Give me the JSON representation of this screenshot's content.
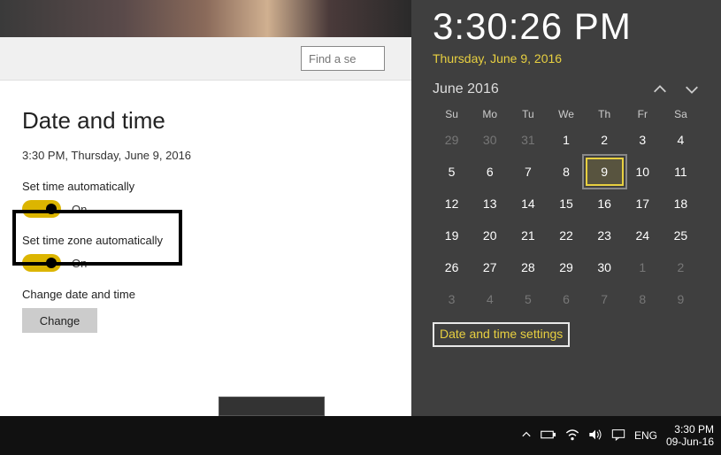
{
  "search": {
    "placeholder": "Find a se"
  },
  "settings": {
    "title": "Date and time",
    "current": "3:30 PM, Thursday, June 9, 2016",
    "set_time_auto": {
      "label": "Set time automatically",
      "state": "On"
    },
    "set_tz_auto": {
      "label": "Set time zone automatically",
      "state": "On"
    },
    "change_section": {
      "label": "Change date and time",
      "button": "Change"
    }
  },
  "flyout": {
    "time": "3:30:26 PM",
    "date": "Thursday, June 9, 2016",
    "month": "June 2016",
    "weekdays": [
      "Su",
      "Mo",
      "Tu",
      "We",
      "Th",
      "Fr",
      "Sa"
    ],
    "weeks": [
      [
        {
          "n": "29",
          "o": true
        },
        {
          "n": "30",
          "o": true
        },
        {
          "n": "31",
          "o": true
        },
        {
          "n": "1"
        },
        {
          "n": "2"
        },
        {
          "n": "3"
        },
        {
          "n": "4"
        }
      ],
      [
        {
          "n": "5"
        },
        {
          "n": "6"
        },
        {
          "n": "7"
        },
        {
          "n": "8"
        },
        {
          "n": "9",
          "today": true
        },
        {
          "n": "10"
        },
        {
          "n": "11"
        }
      ],
      [
        {
          "n": "12"
        },
        {
          "n": "13"
        },
        {
          "n": "14"
        },
        {
          "n": "15"
        },
        {
          "n": "16"
        },
        {
          "n": "17"
        },
        {
          "n": "18"
        }
      ],
      [
        {
          "n": "19"
        },
        {
          "n": "20"
        },
        {
          "n": "21"
        },
        {
          "n": "22"
        },
        {
          "n": "23"
        },
        {
          "n": "24"
        },
        {
          "n": "25"
        }
      ],
      [
        {
          "n": "26"
        },
        {
          "n": "27"
        },
        {
          "n": "28"
        },
        {
          "n": "29"
        },
        {
          "n": "30"
        },
        {
          "n": "1",
          "o": true
        },
        {
          "n": "2",
          "o": true
        }
      ],
      [
        {
          "n": "3",
          "o": true
        },
        {
          "n": "4",
          "o": true
        },
        {
          "n": "5",
          "o": true
        },
        {
          "n": "6",
          "o": true
        },
        {
          "n": "7",
          "o": true
        },
        {
          "n": "8",
          "o": true
        },
        {
          "n": "9",
          "o": true
        }
      ]
    ],
    "settings_link": "Date and time settings"
  },
  "taskbar": {
    "lang": "ENG",
    "time": "3:30 PM",
    "date": "09-Jun-16"
  }
}
